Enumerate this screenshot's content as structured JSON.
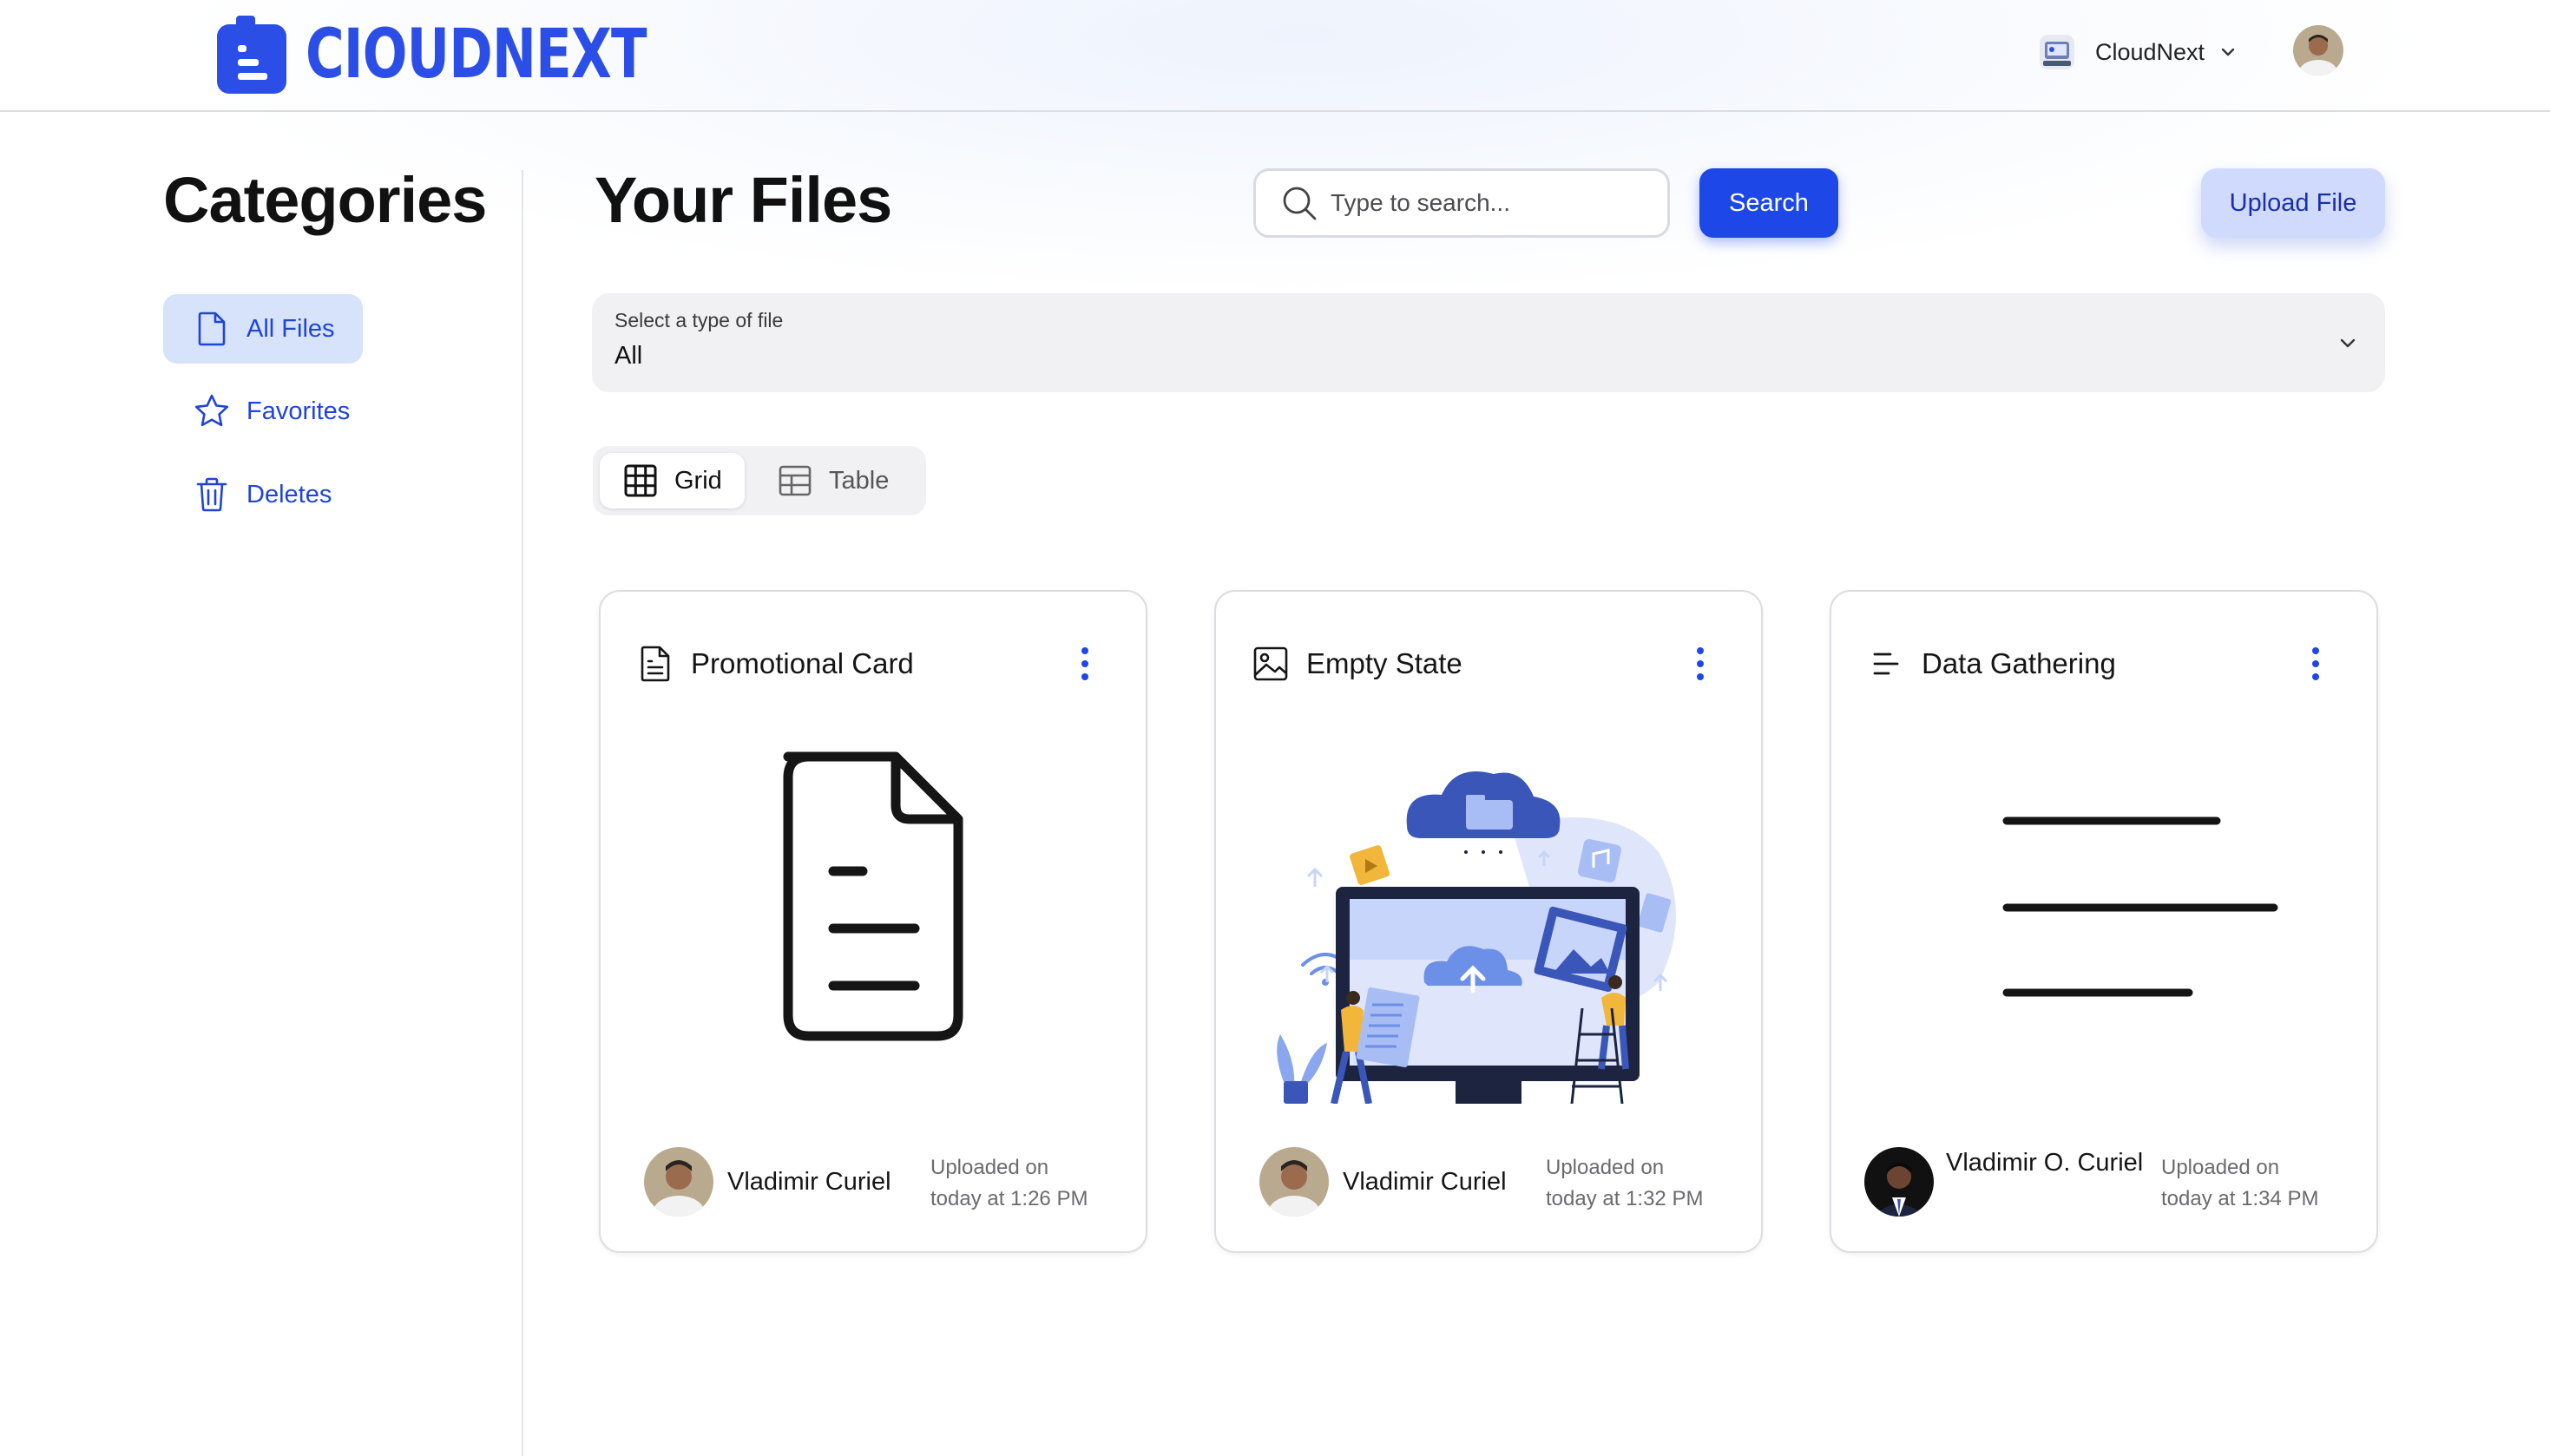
{
  "header": {
    "logo_text": "CIOUDNEXT",
    "org_name": "CloudNext"
  },
  "sidebar": {
    "title": "Categories",
    "items": [
      {
        "label": "All Files",
        "icon": "file-icon",
        "active": true
      },
      {
        "label": "Favorites",
        "icon": "star-icon",
        "active": false
      },
      {
        "label": "Deletes",
        "icon": "trash-icon",
        "active": false
      }
    ]
  },
  "main": {
    "title": "Your Files",
    "search": {
      "placeholder": "Type to search...",
      "button_label": "Search"
    },
    "upload_label": "Upload File",
    "type_select": {
      "label": "Select a type of file",
      "value": "All"
    },
    "view_toggle": [
      {
        "label": "Grid",
        "icon": "grid-icon",
        "active": true
      },
      {
        "label": "Table",
        "icon": "table-icon",
        "active": false
      }
    ],
    "cards": [
      {
        "title": "Promotional Card",
        "icon": "document-icon",
        "author": "Vladimir Curiel",
        "uploaded_line1": "Uploaded on",
        "uploaded_line2": "today at 1:26 PM"
      },
      {
        "title": "Empty State",
        "icon": "image-icon",
        "author": "Vladimir Curiel",
        "uploaded_line1": "Uploaded on",
        "uploaded_line2": "today at 1:32 PM"
      },
      {
        "title": "Data Gathering",
        "icon": "text-lines-icon",
        "author": "Vladimir O. Curiel",
        "uploaded_line1": "Uploaded on",
        "uploaded_line2": "today at 1:34 PM"
      }
    ]
  },
  "colors": {
    "accent": "#1e47e8",
    "brand": "#2b4ee6",
    "active_nav_bg": "#d6e3fb",
    "upload_bg": "#cfdafc"
  }
}
